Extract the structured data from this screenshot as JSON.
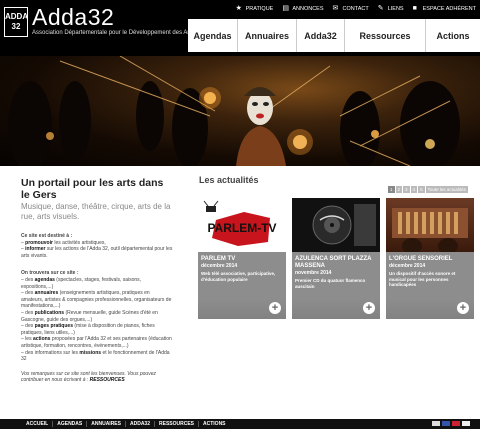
{
  "brand": {
    "name": "Adda32",
    "tagline": "Association Départementale pour le Développement des Arts",
    "logo_text": "ADDA 32"
  },
  "topbar": [
    {
      "label": "PRATIQUE",
      "icon": "star-icon"
    },
    {
      "label": "ANNONCES",
      "icon": "document-icon"
    },
    {
      "label": "CONTACT",
      "icon": "envelope-icon"
    },
    {
      "label": "LIENS",
      "icon": "link-icon"
    },
    {
      "label": "ESPACE ADHÉRENT",
      "icon": "lock-icon"
    }
  ],
  "mainnav": [
    "Agendas",
    "Annuaires",
    "Adda32",
    "Ressources",
    "Actions"
  ],
  "intro": {
    "title": "Un portail pour les arts dans le Gers",
    "subtitle": "Musique, danse, théâtre, cirque, arts de la rue, arts visuels.",
    "dest_title": "Ce site est destiné à :",
    "dest_items": [
      [
        "promouvoir",
        " les activités artistiques,"
      ],
      [
        "informer",
        " sur les actions de l'Adda 32, outil départemental pour les arts vivants."
      ]
    ],
    "find_title": "On trouvera sur ce site :",
    "find_items": [
      [
        "des ",
        "agendas",
        " (spectacles, stages, festivals, saisons, expositions,...)"
      ],
      [
        "des ",
        "annuaires",
        " (enseignements artistiques, pratiques en amateurs, artistes & compagnies professionnelles, organisateurs de manifestations,...)"
      ],
      [
        "des ",
        "publications",
        " (Revue mensuelle, guide Scènes d'été en Gascogne, guide des orgues,...)"
      ],
      [
        "des ",
        "pages pratiques",
        " (mise à disposition de pianos, fiches pratiques, liens utiles,...)"
      ],
      [
        "les ",
        "actions",
        " proposées par l'Adda 32 et ses partenaires (éducation artistique, formation, rencontres, événements,...)"
      ],
      [
        "des informations sur les ",
        "missions",
        " et le fonctionnement de l'Adda 32"
      ]
    ],
    "closing_pre": "Vos remarques sur ce site sont les bienvenues. Vous pouvez contribuer en nous écrivant à : ",
    "closing_link": "RESSOURCES"
  },
  "news": {
    "heading": "Les actualités",
    "pager": [
      "1",
      "2",
      "3",
      "4",
      "5"
    ],
    "pager_all": "Toute les actualités",
    "cards": [
      {
        "title": "PARLEM TV",
        "date": "décembre 2014",
        "desc": "Web télé associative, participative, d'éducation populaire",
        "thumb_text": "PARLEM-TV"
      },
      {
        "title": "AZULENCA SORT PLAZZA MASSENA",
        "date": "novembre 2014",
        "desc": "Premier CD du quatuor flamenco auscitain",
        "thumb_text": ""
      },
      {
        "title": "L'ORGUE SENSORIEL",
        "date": "décembre 2014",
        "desc": "Un dispositif d'accès sonore et musical pour les personnes handicapées",
        "thumb_text": ""
      }
    ]
  },
  "footer": [
    "ACCUEIL",
    "AGENDAS",
    "ANNUAIRES",
    "ADDA32",
    "RESSOURCES",
    "ACTIONS"
  ],
  "colors": {
    "header_bg": "#000000",
    "card_bg": "#8d8d8d",
    "accent": "#222222"
  }
}
